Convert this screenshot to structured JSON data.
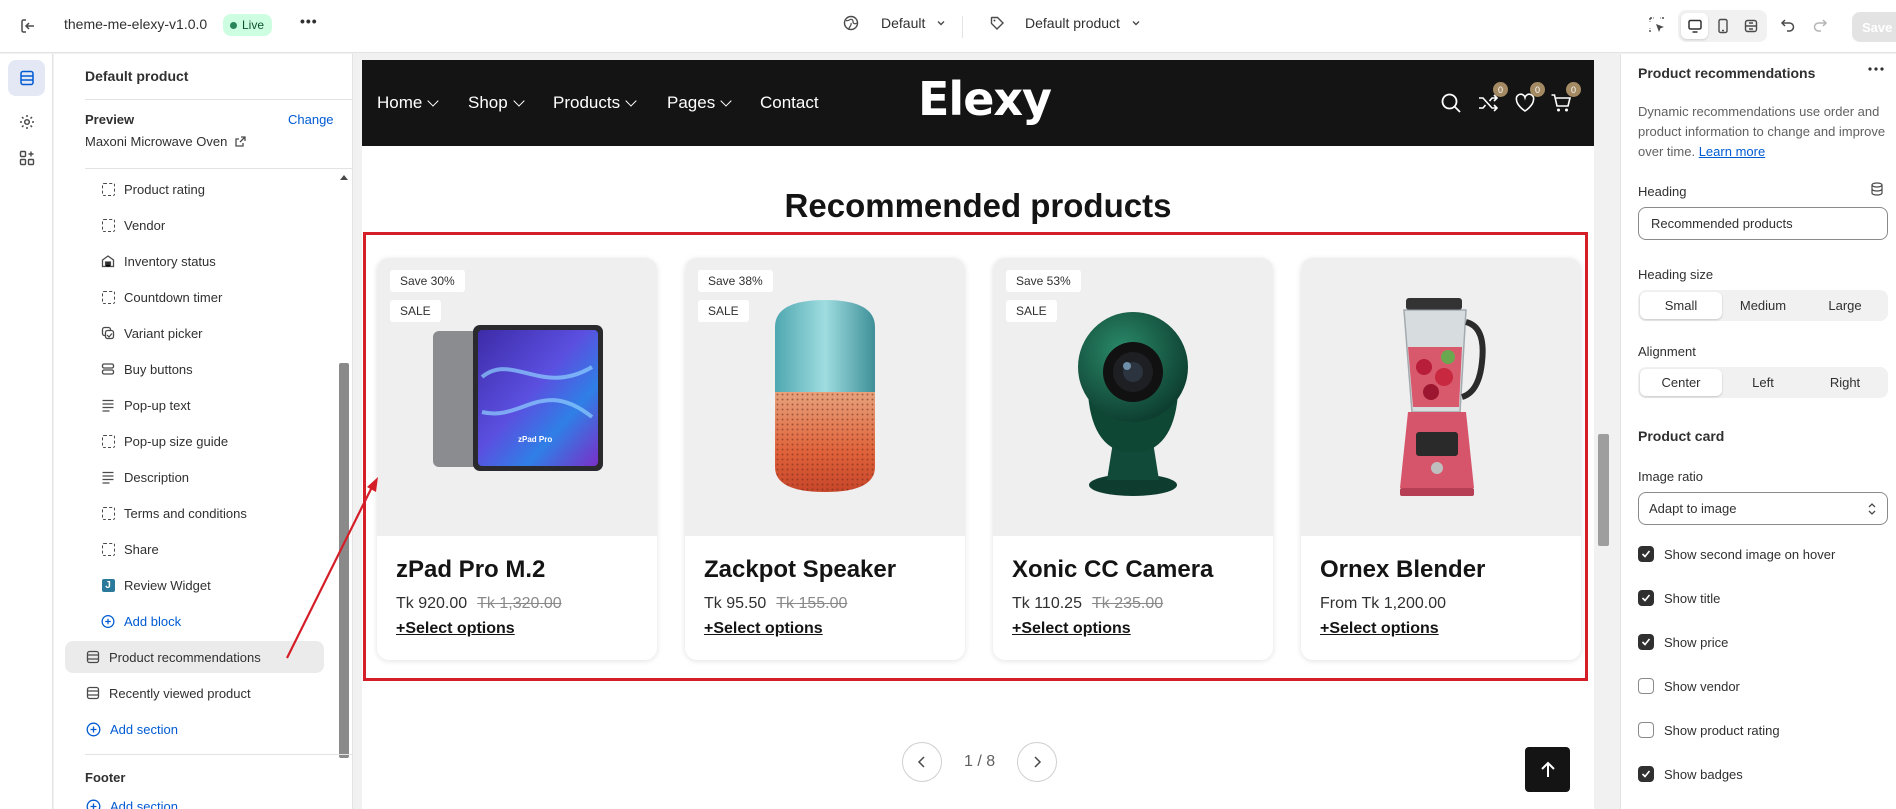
{
  "topbar": {
    "theme_name": "theme-me-elexy-v1.0.0",
    "live_label": "Live",
    "more_label": "•••",
    "locale_select": "Default",
    "template_select": "Default product",
    "save_label": "Save"
  },
  "left_panel": {
    "title": "Default product",
    "preview_label": "Preview",
    "change_label": "Change",
    "preview_product": "Maxoni Microwave Oven",
    "blocks": [
      {
        "label": "Product rating",
        "icon": "dashed-block-icon"
      },
      {
        "label": "Vendor",
        "icon": "dashed-block-icon"
      },
      {
        "label": "Inventory status",
        "icon": "inventory-icon"
      },
      {
        "label": "Countdown timer",
        "icon": "dashed-block-icon"
      },
      {
        "label": "Variant picker",
        "icon": "variant-icon"
      },
      {
        "label": "Buy buttons",
        "icon": "buy-buttons-icon"
      },
      {
        "label": "Pop-up text",
        "icon": "text-lines-icon"
      },
      {
        "label": "Pop-up size guide",
        "icon": "dashed-block-icon"
      },
      {
        "label": "Description",
        "icon": "text-lines-icon"
      },
      {
        "label": "Terms and conditions",
        "icon": "dashed-block-icon"
      },
      {
        "label": "Share",
        "icon": "dashed-block-icon"
      },
      {
        "label": "Review Widget",
        "icon": "review-app-icon"
      }
    ],
    "add_block_label": "Add block",
    "sections": [
      {
        "label": "Product recommendations",
        "selected": true
      },
      {
        "label": "Recently viewed product",
        "selected": false
      }
    ],
    "add_section_label": "Add section",
    "footer_label": "Footer",
    "footer_add_section_label": "Add section"
  },
  "store": {
    "nav": [
      "Home",
      "Shop",
      "Products",
      "Pages",
      "Contact"
    ],
    "logo": "Elexy",
    "compare_count": "0",
    "wishlist_count": "0",
    "cart_count": "0",
    "section_title": "Recommended products",
    "products": [
      {
        "title": "zPad Pro M.2",
        "price": "Tk 920.00",
        "old_price": "Tk 1,320.00",
        "save": "Save 30%",
        "sale": "SALE",
        "action": "+Select options",
        "image": "tablet-image"
      },
      {
        "title": "Zackpot Speaker",
        "price": "Tk 95.50",
        "old_price": "Tk 155.00",
        "save": "Save 38%",
        "sale": "SALE",
        "action": "+Select options",
        "image": "speaker-image"
      },
      {
        "title": "Xonic CC Camera",
        "price": "Tk 110.25",
        "old_price": "Tk 235.00",
        "save": "Save 53%",
        "sale": "SALE",
        "action": "+Select options",
        "image": "camera-image"
      },
      {
        "title": "Ornex Blender",
        "price": "From Tk 1,200.00",
        "old_price": "",
        "save": "",
        "sale": "",
        "action": "+Select options",
        "image": "blender-image"
      }
    ],
    "tablet_text": "zPad Pro",
    "pager": "1 / 8",
    "accent_red": "#d41e28"
  },
  "right_panel": {
    "title": "Product recommendations",
    "description": "Dynamic recommendations use order and product information to change and improve over time.",
    "learn_more": "Learn more",
    "heading_label": "Heading",
    "heading_value": "Recommended products",
    "heading_size_label": "Heading size",
    "heading_size_options": [
      "Small",
      "Medium",
      "Large"
    ],
    "heading_size_selected": "Small",
    "alignment_label": "Alignment",
    "alignment_options": [
      "Center",
      "Left",
      "Right"
    ],
    "alignment_selected": "Center",
    "product_card_label": "Product card",
    "image_ratio_label": "Image ratio",
    "image_ratio_value": "Adapt to image",
    "checkboxes": [
      {
        "label": "Show second image on hover",
        "checked": true
      },
      {
        "label": "Show title",
        "checked": true
      },
      {
        "label": "Show price",
        "checked": true
      },
      {
        "label": "Show vendor",
        "checked": false
      },
      {
        "label": "Show product rating",
        "checked": false
      },
      {
        "label": "Show badges",
        "checked": true
      }
    ]
  }
}
